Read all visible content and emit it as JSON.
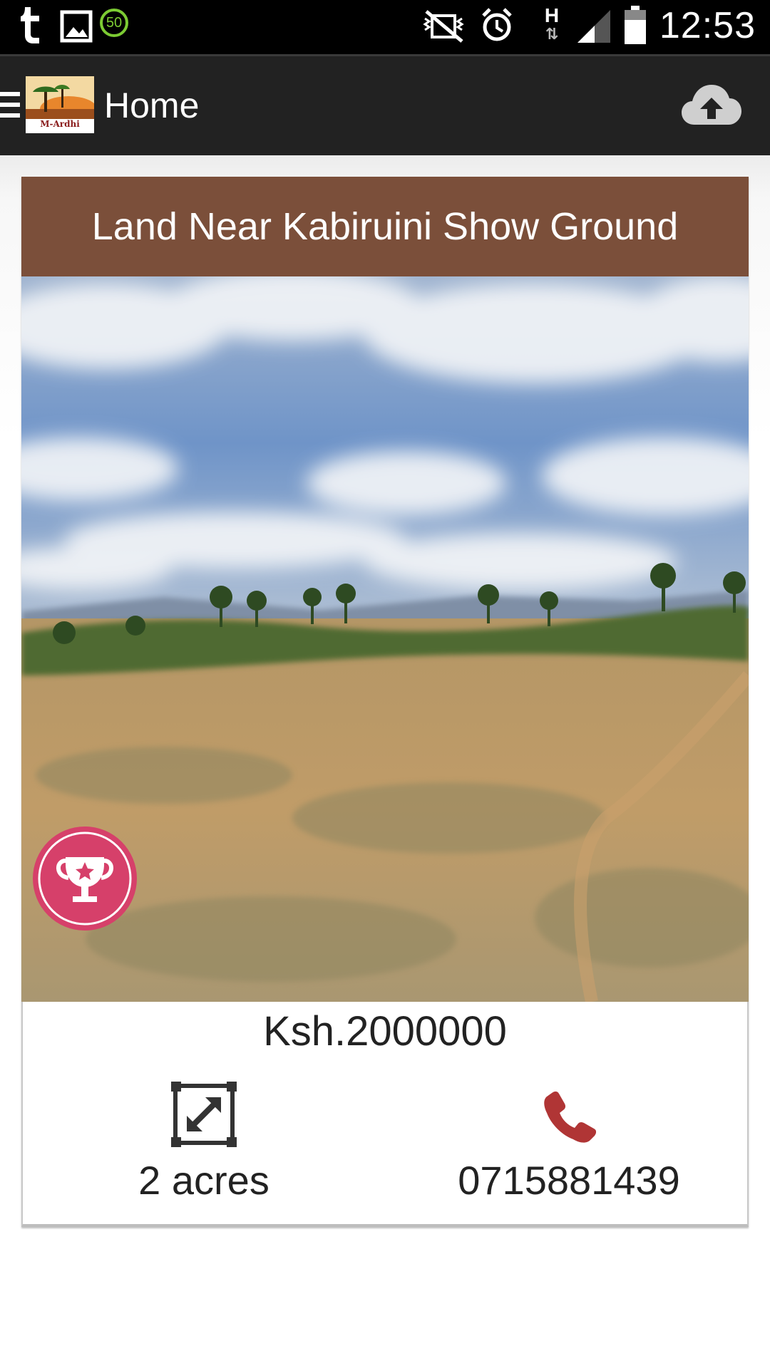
{
  "status_bar": {
    "time": "12:53",
    "icons": [
      "tumblr-icon",
      "gallery-icon",
      "speed-50-icon",
      "mute-icon",
      "alarm-icon",
      "hspa-data-icon",
      "signal-icon",
      "battery-icon"
    ],
    "badge_number": "50",
    "network_letter": "H"
  },
  "app_bar": {
    "title": "Home",
    "logo_text": "M-Ardhi",
    "icons": [
      "menu-icon",
      "app-logo",
      "cloud-upload-icon"
    ]
  },
  "listing": {
    "title": "Land Near Kabiruini Show Ground",
    "price": "Ksh.2000000",
    "size": "2 acres",
    "phone": "0715881439",
    "icons": [
      "trophy-badge-icon",
      "resize-icon",
      "phone-icon"
    ]
  },
  "colors": {
    "title_bar": "#7b4f3a",
    "app_bar": "#222222",
    "badge": "#d6406a",
    "phone_icon": "#b03535"
  }
}
